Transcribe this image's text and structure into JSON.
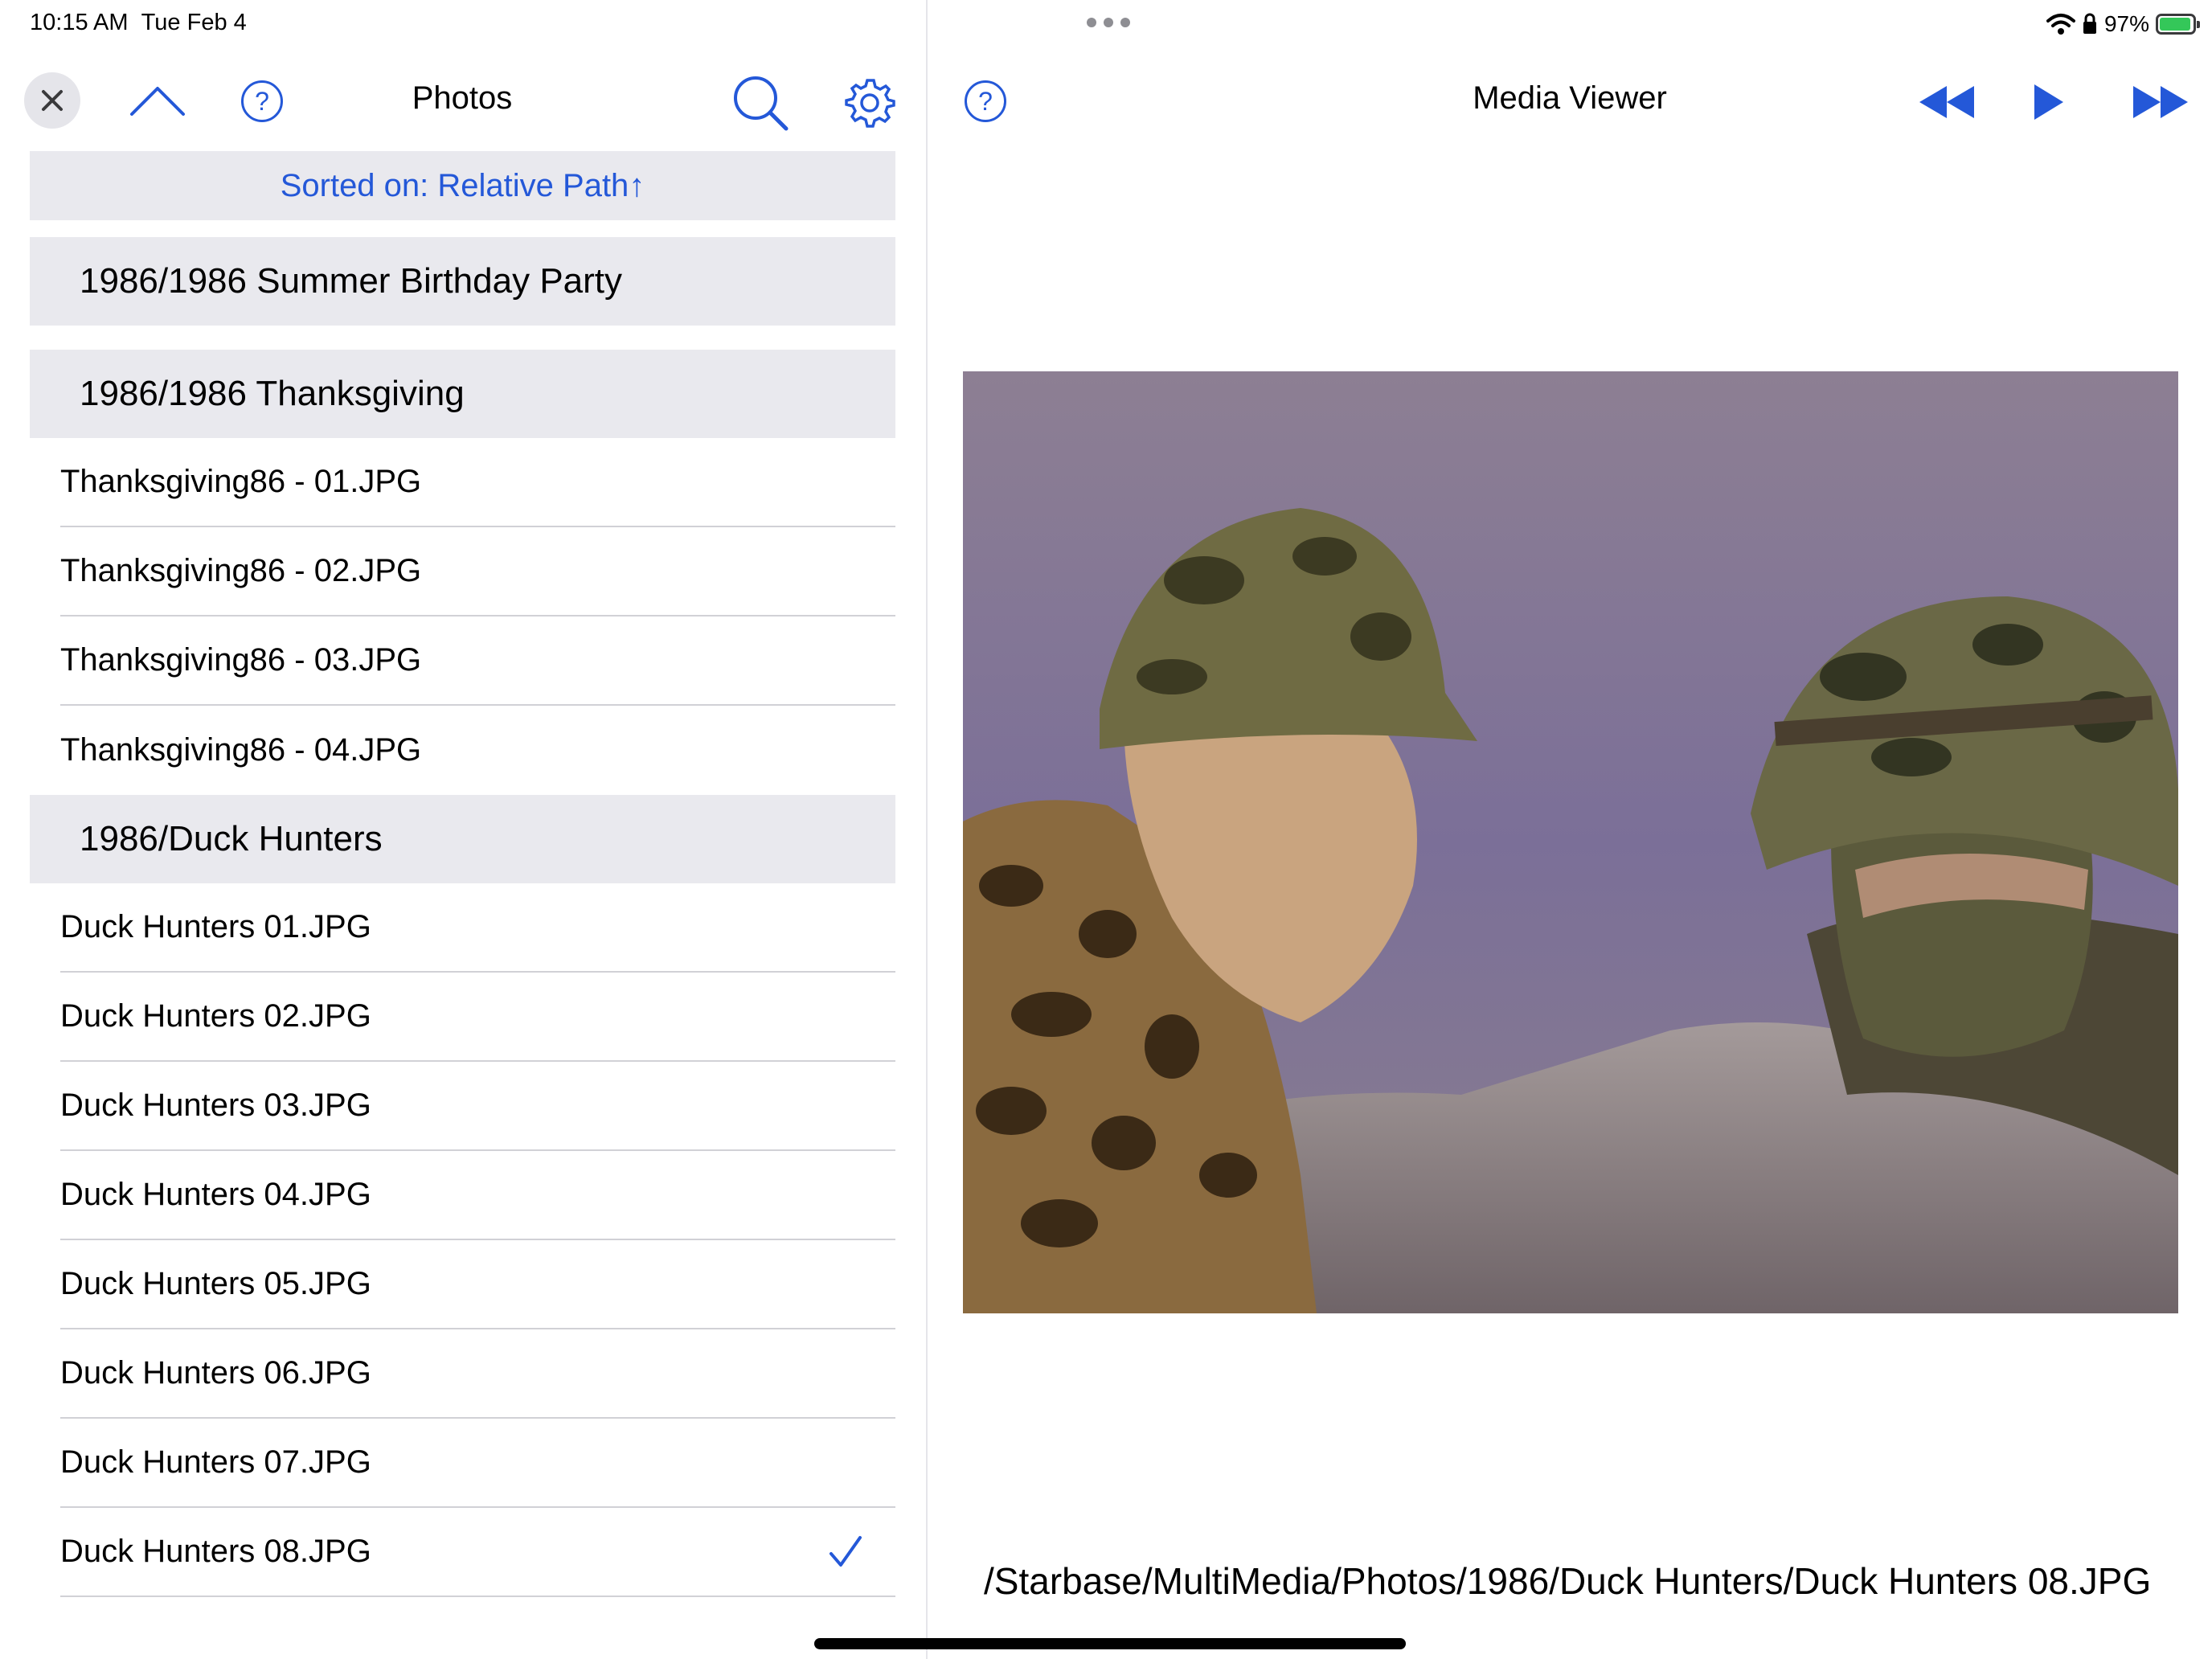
{
  "status": {
    "time": "10:15 AM",
    "date": "Tue Feb 4",
    "battery": "97%"
  },
  "left": {
    "title": "Photos",
    "sort_label": "Sorted on: Relative Path↑",
    "sections": [
      {
        "title": "1986/1986 Summer Birthday Party",
        "items": []
      },
      {
        "title": "1986/1986 Thanksgiving",
        "items": [
          "Thanksgiving86 - 01.JPG",
          "Thanksgiving86 - 02.JPG",
          "Thanksgiving86 - 03.JPG",
          "Thanksgiving86 - 04.JPG"
        ]
      },
      {
        "title": "1986/Duck Hunters",
        "items": [
          "Duck Hunters 01.JPG",
          "Duck Hunters 02.JPG",
          "Duck Hunters 03.JPG",
          "Duck Hunters 04.JPG",
          "Duck Hunters 05.JPG",
          "Duck Hunters 06.JPG",
          "Duck Hunters 07.JPG",
          "Duck Hunters 08.JPG"
        ]
      }
    ],
    "selected_item": "Duck Hunters 08.JPG"
  },
  "right": {
    "title": "Media Viewer",
    "file_path": "/Starbase/MultiMedia/Photos/1986/Duck Hunters/Duck Hunters 08.JPG"
  },
  "colors": {
    "accent": "#2458d8",
    "section_bg": "#e9e9ee",
    "battery": "#34c759"
  },
  "icons": [
    "close-icon",
    "chevron-up-icon",
    "help-icon",
    "search-icon",
    "gear-icon",
    "rewind-icon",
    "play-icon",
    "fast-forward-icon",
    "wifi-icon",
    "lock-icon",
    "battery-icon",
    "checkmark-icon"
  ]
}
